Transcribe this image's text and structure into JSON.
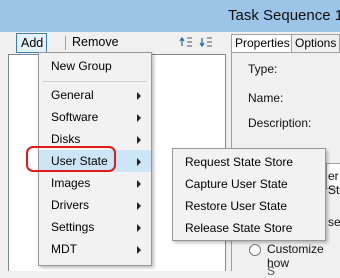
{
  "window": {
    "title": "Task Sequence 1"
  },
  "toolbar": {
    "add_label": "Add",
    "add_arrow": "▾",
    "remove_label": "Remove",
    "icons": [
      "move-up-icon",
      "move-down-icon"
    ]
  },
  "properties": {
    "tabs": [
      {
        "label": "Properties",
        "active": true
      },
      {
        "label": "Options",
        "active": false
      }
    ],
    "fields": [
      {
        "label": "Type:"
      },
      {
        "label": "Name:"
      },
      {
        "label": "Description:"
      }
    ],
    "partial_text_1": "er Sta",
    "partial_text_2": "se",
    "radio_label": "Customize how",
    "partial_text_3": "S"
  },
  "menu": {
    "items": [
      {
        "label": "New Group",
        "submenu": false
      },
      {
        "label": "General",
        "submenu": true
      },
      {
        "label": "Software",
        "submenu": true
      },
      {
        "label": "Disks",
        "submenu": true
      },
      {
        "label": "User State",
        "submenu": true,
        "highlighted": true
      },
      {
        "label": "Images",
        "submenu": true
      },
      {
        "label": "Drivers",
        "submenu": true
      },
      {
        "label": "Settings",
        "submenu": true
      },
      {
        "label": "MDT",
        "submenu": true
      }
    ]
  },
  "submenu": {
    "items": [
      {
        "label": "Request State Store"
      },
      {
        "label": "Capture User State"
      },
      {
        "label": "Restore User State"
      },
      {
        "label": "Release State Store"
      }
    ]
  },
  "colors": {
    "titlebar": "#9bc4e8",
    "highlight_ring": "#e01b1b",
    "hover_bg": "#cde6f7"
  }
}
